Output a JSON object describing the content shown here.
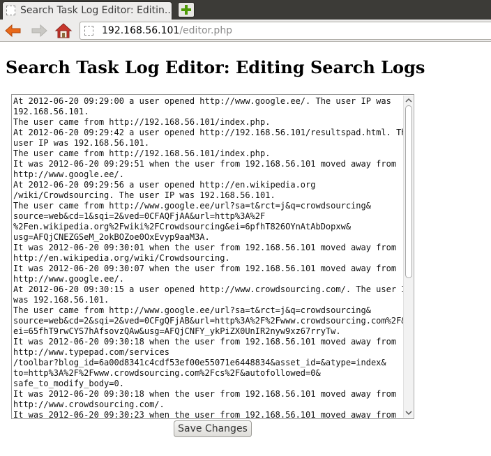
{
  "browser": {
    "tab_title": "Search Task Log Editor: Editin...",
    "url_host": "192.168.56.101",
    "url_path": "/editor.php"
  },
  "page": {
    "title": "Search Task Log Editor: Editing Search Logs",
    "log_lines": [
      "At 2012-06-20 09:29:00 a user opened http://www.google.ee/. The user IP was",
      "192.168.56.101.",
      "The user came from http://192.168.56.101/index.php.",
      "At 2012-06-20 09:29:42 a user opened http://192.168.56.101/resultspad.html. The",
      "user IP was 192.168.56.101.",
      "The user came from http://192.168.56.101/index.php.",
      "It was 2012-06-20 09:29:51 when the user from 192.168.56.101 moved away from",
      "http://www.google.ee/.",
      "At 2012-06-20 09:29:56 a user opened http://en.wikipedia.org",
      "/wiki/Crowdsourcing. The user IP was 192.168.56.101.",
      "The user came from http://www.google.ee/url?sa=t&rct=j&q=crowdsourcing&",
      "source=web&cd=1&sqi=2&ved=0CFAQFjAA&url=http%3A%2F",
      "%2Fen.wikipedia.org%2Fwiki%2FCrowdsourcing&ei=6pfhT826OYnAtAbDopxw&",
      "usg=AFQjCNEZGSeM_2okBOZoe0OxEvyp9aaM3A.",
      "It was 2012-06-20 09:30:01 when the user from 192.168.56.101 moved away from",
      "http://en.wikipedia.org/wiki/Crowdsourcing.",
      "It was 2012-06-20 09:30:07 when the user from 192.168.56.101 moved away from",
      "http://www.google.ee/.",
      "At 2012-06-20 09:30:15 a user opened http://www.crowdsourcing.com/. The user IP",
      "was 192.168.56.101.",
      "The user came from http://www.google.ee/url?sa=t&rct=j&q=crowdsourcing&",
      "source=web&cd=2&sqi=2&ved=0CFgQFjAB&url=http%3A%2F%2Fwww.crowdsourcing.com%2F&",
      "ei=65fhT9rwCYS7hAfsovzQAw&usg=AFQjCNFY_ykPiZX0UnIR2nyw9xz67rryTw.",
      "It was 2012-06-20 09:30:18 when the user from 192.168.56.101 moved away from",
      "http://www.typepad.com/services",
      "/toolbar?blog_id=6a00d8341c4cdf53ef00e55071e6448834&asset_id=&atype=index&",
      "to=http%3A%2F%2Fwww.crowdsourcing.com%2Fcs%2F&autofollowed=0&",
      "safe_to_modify_body=0.",
      "It was 2012-06-20 09:30:18 when the user from 192.168.56.101 moved away from",
      "http://www.crowdsourcing.com/.",
      "It was 2012-06-20 09:30:23 when the user from 192.168.56.101 moved away from"
    ],
    "save_label": "Save Changes"
  },
  "icons": {
    "back": "back-arrow-icon",
    "forward": "forward-arrow-icon",
    "home": "home-icon",
    "new_tab": "plus-icon",
    "page": "page-icon"
  },
  "colors": {
    "back_arrow": "#e8691a",
    "new_tab_plus": "#4e9a06",
    "home_roof": "#c8372d"
  }
}
